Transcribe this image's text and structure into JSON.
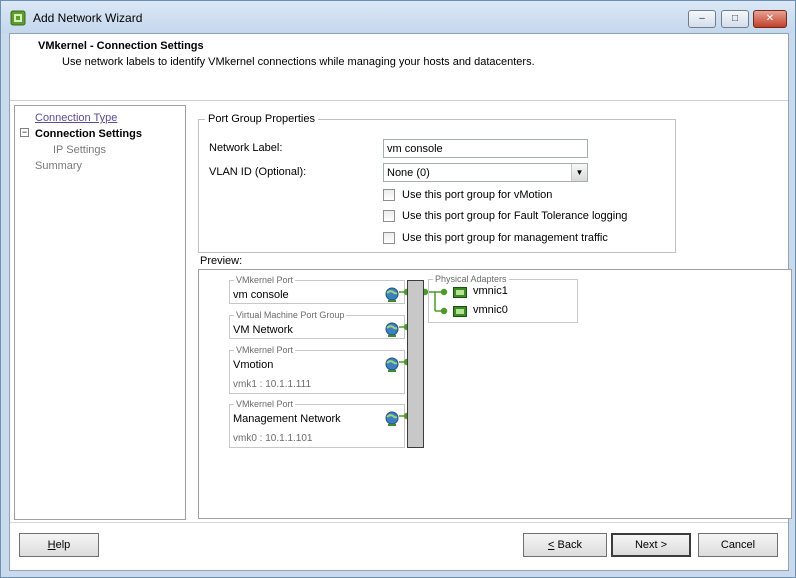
{
  "window": {
    "title": "Add Network Wizard",
    "min_glyph": "–",
    "max_glyph": "□",
    "close_glyph": "✕"
  },
  "header": {
    "title": "VMkernel - Connection Settings",
    "subtitle": "Use network labels to identify VMkernel connections while managing your hosts and datacenters."
  },
  "steps": {
    "connection_type": "Connection Type",
    "connection_settings": "Connection Settings",
    "ip_settings": "IP Settings",
    "summary": "Summary",
    "collapse_glyph": "−"
  },
  "port_group": {
    "legend": "Port Group Properties",
    "network_label_label": "Network Label:",
    "network_label_value": "vm console",
    "vlan_label": "VLAN ID (Optional):",
    "vlan_value": "None (0)",
    "vmotion": "Use this port group for vMotion",
    "fault_tolerance": "Use this port group for Fault Tolerance logging",
    "management": "Use this port group for management traffic"
  },
  "preview": {
    "label": "Preview:",
    "port_groups": [
      {
        "type": "VMkernel Port",
        "name": "vm console",
        "detail": ""
      },
      {
        "type": "Virtual Machine Port Group",
        "name": "VM Network",
        "detail": ""
      },
      {
        "type": "VMkernel Port",
        "name": "Vmotion",
        "detail": "vmk1 : 10.1.1.111"
      },
      {
        "type": "VMkernel Port",
        "name": "Management Network",
        "detail": "vmk0 : 10.1.1.101"
      }
    ],
    "physical_title": "Physical Adapters",
    "nics": [
      "vmnic1",
      "vmnic0"
    ]
  },
  "footer": {
    "help_pre": "",
    "help_key": "H",
    "help_post": "elp",
    "back_pre": "",
    "back_key": "<",
    "back_post": " Back",
    "next_label": "Next >",
    "cancel_label": "Cancel"
  },
  "colors": {
    "accent_link": "#5b4d93",
    "nic_green": "#3c8c2c",
    "connector_green": "#4c9a2a"
  }
}
